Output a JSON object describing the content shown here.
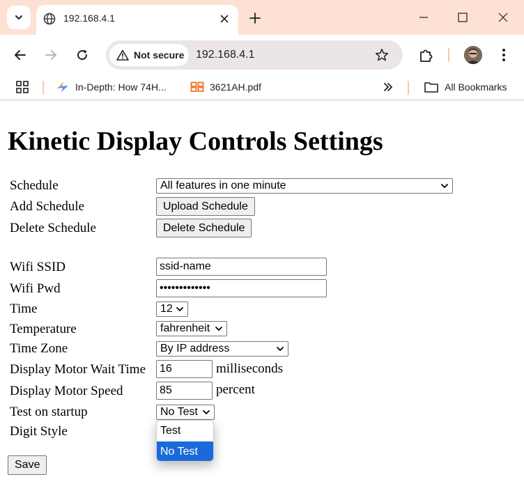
{
  "browser": {
    "tab": {
      "title": "192.168.4.1"
    },
    "omnibox": {
      "security": "Not secure",
      "url": "192.168.4.1"
    },
    "bookmarks": [
      {
        "label": "In-Depth: How 74H...",
        "icon": "bookmark-lightning-icon"
      },
      {
        "label": "3621AH.pdf",
        "icon": "bookmark-88-icon"
      }
    ],
    "all_bookmarks": "All Bookmarks",
    "colors": {
      "titlebar": "#fde1d3",
      "omnibox": "#ebe6e5"
    }
  },
  "page": {
    "title": "Kinetic Display Controls Settings",
    "schedule": {
      "label": "Schedule",
      "value": "All features in one minute"
    },
    "add_schedule": {
      "label": "Add Schedule",
      "button": "Upload Schedule"
    },
    "delete_schedule": {
      "label": "Delete Schedule",
      "button": "Delete Schedule"
    },
    "wifi_ssid": {
      "label": "Wifi SSID",
      "value": "ssid-name"
    },
    "wifi_pwd": {
      "label": "Wifi Pwd",
      "value": "•••••••••••••"
    },
    "time": {
      "label": "Time",
      "value": "12"
    },
    "temperature": {
      "label": "Temperature",
      "value": "fahrenheit"
    },
    "time_zone": {
      "label": "Time Zone",
      "value": "By IP address"
    },
    "motor_wait": {
      "label": "Display Motor Wait Time",
      "value": "16",
      "unit": "milliseconds"
    },
    "motor_speed": {
      "label": "Display Motor Speed",
      "value": "85",
      "unit": "percent"
    },
    "test_on_startup": {
      "label": "Test on startup",
      "value": "No Test",
      "options": [
        "Test",
        "No Test"
      ],
      "highlighted": "No Test"
    },
    "digit_style": {
      "label": "Digit Style"
    },
    "save": "Save",
    "colors": {
      "highlight": "#1a6bd9"
    }
  }
}
